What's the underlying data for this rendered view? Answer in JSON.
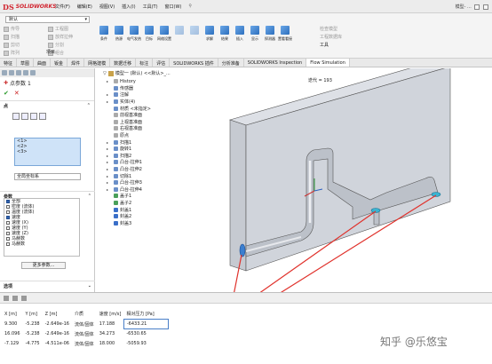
{
  "app": {
    "logo_ds": "DS",
    "logo_text": "SOLIDWORKS",
    "menus": [
      "文件(F)",
      "编辑(E)",
      "视图(V)",
      "插入(I)",
      "工具(T)",
      "窗口(W)"
    ],
    "title_right": "模型- ..."
  },
  "ribbon": {
    "config_value": "默认",
    "left_items": [
      "传导",
      "工程图",
      "扫描",
      "放样拉伸",
      "剪切",
      "分割",
      "阵列",
      "组合"
    ],
    "tools": [
      "条件",
      "热源",
      "电气发热",
      "目标",
      "网络设置",
      "",
      "",
      "求解",
      "结果",
      "插入",
      "显示",
      "探测器",
      "置看看接"
    ],
    "right_items": [
      "检查模型",
      "工程数据库",
      "工具"
    ],
    "project_label": "项目"
  },
  "tabs": [
    "特征",
    "草图",
    "曲面",
    "钣金",
    "焊件",
    "网格建模",
    "数据迁移",
    "标注",
    "评估",
    "SOLIDWORKS 插件",
    "分析准备",
    "SOLIDWORKS Inspection",
    "Flow Simulation"
  ],
  "active_tab": "Flow Simulation",
  "property_manager": {
    "title": "点参数 1",
    "points_section": "点",
    "points": [
      "<1>",
      "<2>",
      "<3>"
    ],
    "coord_system": "全局坐标系",
    "params_section": "参数",
    "params": [
      {
        "label": "全部",
        "checked": true
      },
      {
        "label": "密度 (流体)",
        "checked": false
      },
      {
        "label": "温度 (流体)",
        "checked": false
      },
      {
        "label": "速度",
        "checked": true
      },
      {
        "label": "速度 (X)",
        "checked": false
      },
      {
        "label": "速度 (Y)",
        "checked": false
      },
      {
        "label": "速度 (Z)",
        "checked": false
      },
      {
        "label": "马赫数",
        "checked": false
      },
      {
        "label": "马赫数",
        "checked": false
      }
    ],
    "more_button": "更多参数...",
    "options_section": "选项"
  },
  "feature_tree": {
    "header": "模型一 (默认) <<默认>_...",
    "items": [
      {
        "label": "History",
        "icon": "gray",
        "expand": true
      },
      {
        "label": "传感器",
        "icon": "blue",
        "expand": false
      },
      {
        "label": "注解",
        "icon": "blue",
        "expand": true
      },
      {
        "label": "实体(4)",
        "icon": "blue",
        "expand": true
      },
      {
        "label": "材质 <未指定>",
        "icon": "blue",
        "expand": false
      },
      {
        "label": "前视基准面",
        "icon": "gray",
        "expand": false
      },
      {
        "label": "上视基准面",
        "icon": "gray",
        "expand": false
      },
      {
        "label": "右视基准面",
        "icon": "gray",
        "expand": false
      },
      {
        "label": "原点",
        "icon": "gray",
        "expand": false
      },
      {
        "label": "扫描1",
        "icon": "blue",
        "expand": true
      },
      {
        "label": "旋转1",
        "icon": "blue",
        "expand": true
      },
      {
        "label": "扫描2",
        "icon": "blue",
        "expand": true
      },
      {
        "label": "凸台-拉伸1",
        "icon": "blue",
        "expand": true
      },
      {
        "label": "凸台-拉伸2",
        "icon": "blue",
        "expand": true
      },
      {
        "label": "切除1",
        "icon": "blue",
        "expand": true
      },
      {
        "label": "凸台-拉伸3",
        "icon": "blue",
        "expand": true
      },
      {
        "label": "凸台-拉伸4",
        "icon": "blue",
        "expand": true
      },
      {
        "label": "盖子1",
        "icon": "green",
        "expand": false
      },
      {
        "label": "盖子2",
        "icon": "green",
        "expand": false
      },
      {
        "label": "封盖1",
        "icon": "sel",
        "expand": false
      },
      {
        "label": "封盖2",
        "icon": "sel",
        "expand": false
      },
      {
        "label": "封盖3",
        "icon": "sel",
        "expand": false
      }
    ]
  },
  "viewport": {
    "iteration_label": "迭代 = 193"
  },
  "results": {
    "headers": [
      "X [m]",
      "Y [m]",
      "Z [m]",
      "介质",
      "速度 [m/s]",
      "相对压力 [Pa]"
    ],
    "rows": [
      [
        "9.300",
        "-5.238",
        "-2.649e-16",
        "流体/固体",
        "17.188",
        "-6433.21"
      ],
      [
        "16.096",
        "-5.238",
        "-2.649e-16",
        "流体/固体",
        "34.273",
        "-6530.65"
      ],
      [
        "-7.129",
        "-4.775",
        "-4.511e-06",
        "流体/固体",
        "18.000",
        "-5059.93"
      ]
    ]
  },
  "watermark": {
    "text": "知乎 @乐悠宝"
  },
  "colors": {
    "arrow": "#e0312b",
    "plate": "#cfd3da",
    "pipe": "#b9bec6",
    "accent": "#3a6fc8"
  }
}
